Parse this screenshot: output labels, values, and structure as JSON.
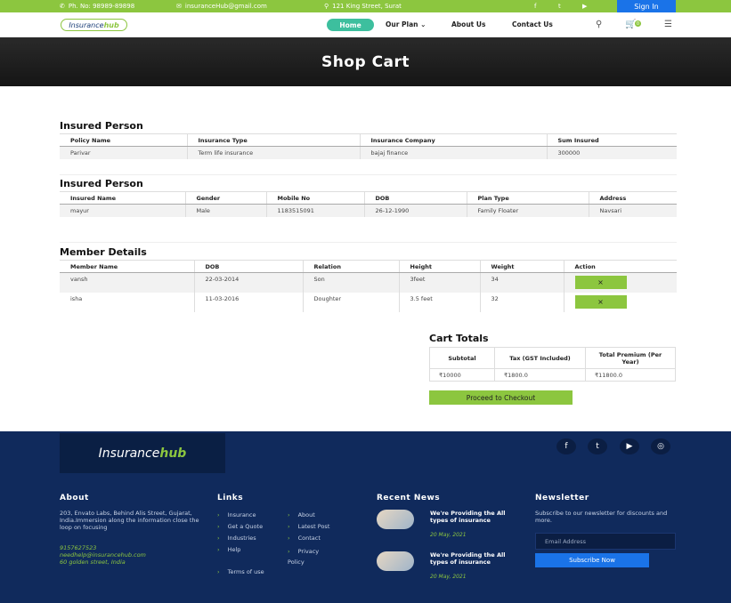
{
  "topbar": {
    "phone": "Ph. No: 98989-89898",
    "email": "insuranceHub@gmail.com",
    "address": "121 King Street, Surat",
    "signin": "Sign In"
  },
  "nav": {
    "logo_a": "Insurance",
    "logo_b": "hub",
    "home": "Home",
    "our_plan": "Our Plan",
    "about": "About Us",
    "contact": "Contact Us",
    "cart_count": "0"
  },
  "banner": {
    "title": "Shop Cart"
  },
  "policy": {
    "title": "Insured Person",
    "headers": [
      "Policy Name",
      "Insurance Type",
      "Insurance Company",
      "Sum Insured"
    ],
    "row": [
      "Parivar",
      "Term life insurance",
      "bajaj finance",
      "300000"
    ]
  },
  "person": {
    "title": "Insured Person",
    "headers": [
      "Insured Name",
      "Gender",
      "Mobile No",
      "DOB",
      "Plan Type",
      "Address"
    ],
    "row": [
      "mayur",
      "Male",
      "1183515091",
      "26-12-1990",
      "Family Floater",
      "Navsari"
    ]
  },
  "members": {
    "title": "Member Details",
    "headers": [
      "Member Name",
      "DOB",
      "Relation",
      "Height",
      "Weight",
      "Action"
    ],
    "rows": [
      [
        "vansh",
        "22-03-2014",
        "Son",
        "3feet",
        "34",
        "×"
      ],
      [
        "isha",
        "11-03-2016",
        "Doughter",
        "3.5 feet",
        "32",
        "×"
      ]
    ]
  },
  "cart_totals": {
    "title": "Cart Totals",
    "headers": [
      "Subtotal",
      "Tax (GST Included)",
      "Total Premium (Per Year)"
    ],
    "values": [
      "₹10000",
      "₹1800.0",
      "₹11800.0"
    ],
    "checkout": "Proceed to Checkout"
  },
  "footer": {
    "logo_a": "Insurance",
    "logo_b": "hub",
    "about": {
      "title": "About",
      "text": "203, Envato Labs, Behind Alis Street, Gujarat, India.Immersion along the information close the loop on focusing",
      "phone": "9157627523",
      "email": "needhelp@insurancehub.com",
      "address": "60 golden street, India"
    },
    "links": {
      "title": "Links",
      "col1": [
        "Insurance",
        "Get a Quote",
        "Industries",
        "Help",
        "Terms of use"
      ],
      "col2": [
        "About",
        "Latest Post",
        "Contact",
        "Privacy Policy"
      ]
    },
    "news": {
      "title": "Recent News",
      "items": [
        {
          "title": "We're Providing the All types of insurance",
          "date": "20 May, 2021"
        },
        {
          "title": "We're Providing the All types of insurance",
          "date": "20 May, 2021"
        }
      ]
    },
    "newsletter": {
      "title": "Newsletter",
      "text": "Subscribe to our newsletter for discounts and more.",
      "placeholder": "Email Address",
      "button": "Subscribe Now"
    }
  },
  "colors": {
    "green": "#8cc63f",
    "blue": "#1a73e8",
    "footer": "#102a5c",
    "teal": "#3dbf9e"
  }
}
